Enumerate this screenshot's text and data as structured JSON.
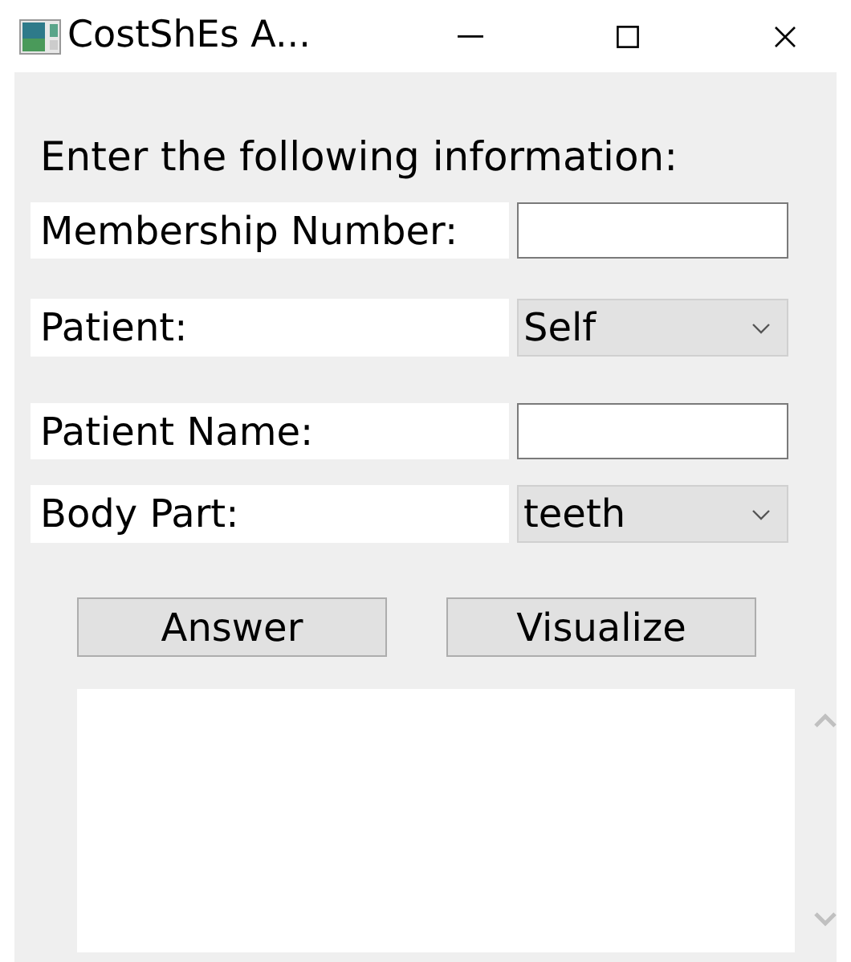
{
  "window": {
    "title": "CostShEs A..."
  },
  "prompt": "Enter the following information:",
  "fields": [
    {
      "label": "Membership Number:",
      "kind": "text"
    },
    {
      "label": "Patient:",
      "kind": "select",
      "value": "Self"
    },
    {
      "label": "Patient Name:",
      "kind": "text"
    },
    {
      "label": "Body Part:",
      "kind": "select",
      "value": "teeth"
    }
  ],
  "buttons": [
    "Answer",
    "Visualize"
  ]
}
